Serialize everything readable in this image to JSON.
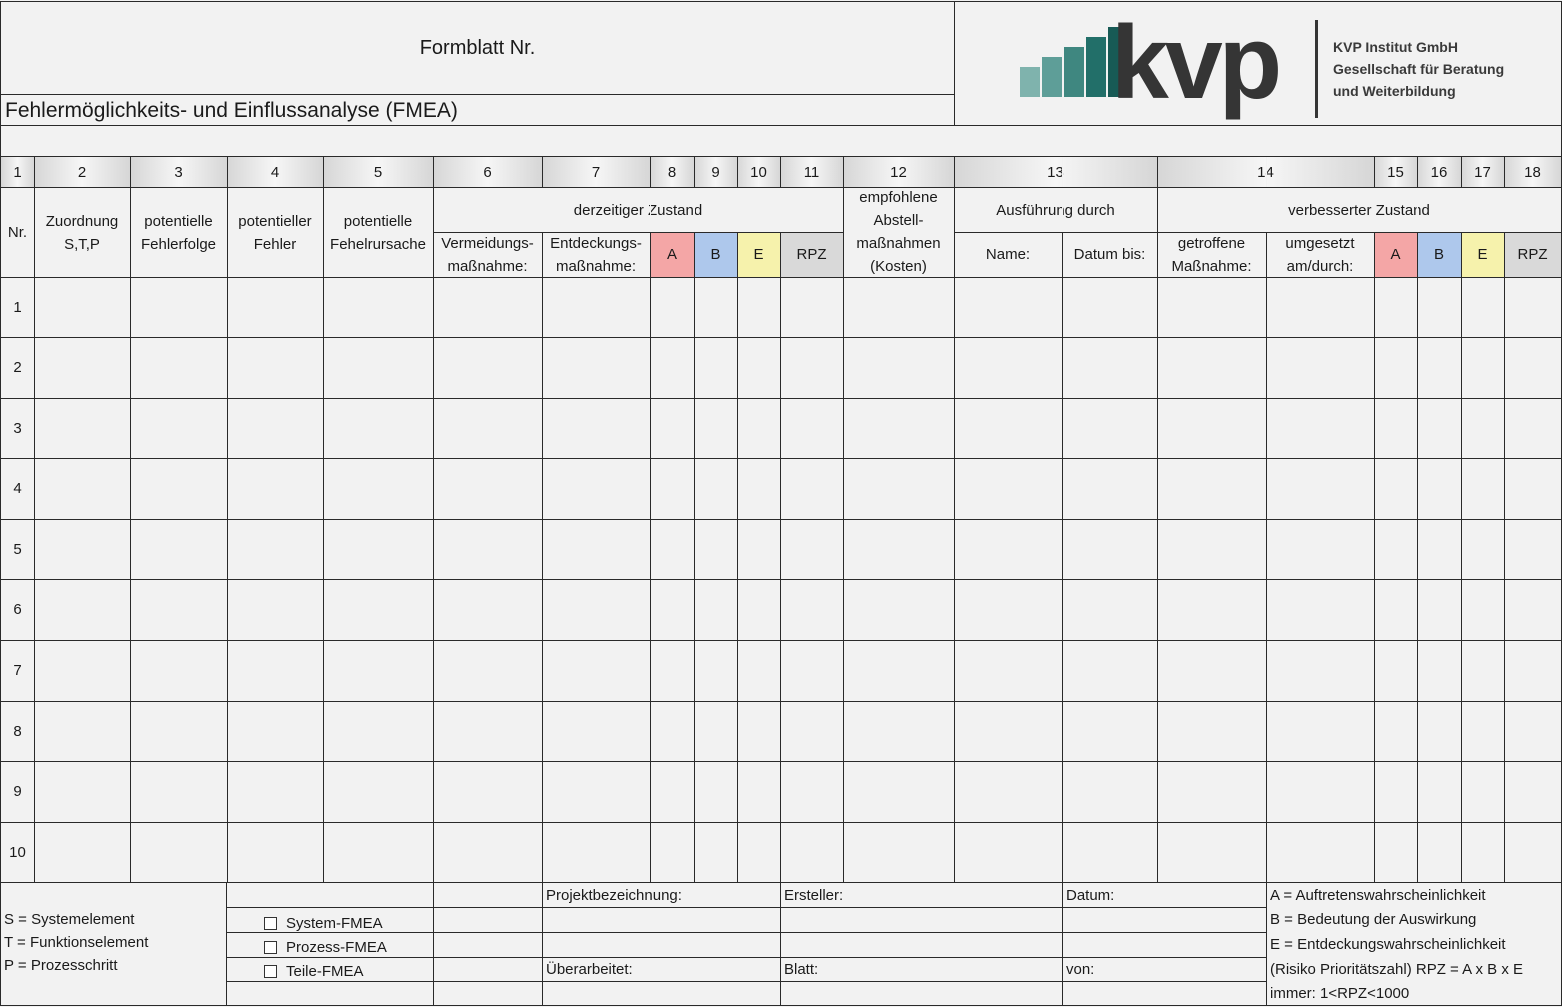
{
  "form": {
    "formblatt_label": "Formblatt Nr.",
    "title": "Fehlermöglichkeits- und Einflussanalyse (FMEA)"
  },
  "logo": {
    "wordmark": "kvp",
    "company_line1": "KVP Institut GmbH",
    "company_line2": "Gesellschaft für Beratung",
    "company_line3": "und Weiterbildung",
    "bar_colors": [
      "#7fb3ad",
      "#5e9e98",
      "#3f8780",
      "#226f69",
      "#175a55"
    ],
    "wordmark_color": "#353535"
  },
  "column_numbers": [
    "1",
    "2",
    "3",
    "4",
    "5",
    "6",
    "7",
    "8",
    "9",
    "10",
    "11",
    "12",
    "13",
    "14",
    "15",
    "16",
    "17",
    "18"
  ],
  "headers": {
    "nr": "Nr.",
    "zuordnung": "Zuordnung S,T,P",
    "fehlerfolge": "potentielle Fehlerfolge",
    "fehler": "potentieller Fehler",
    "fehlerursache": "potentielle Fehelrursache",
    "derzeitiger_zustand": "derzeitiger Zustand",
    "vermeidung": "Vermeidungs-maßnahme:",
    "entdeckung": "Entdeckungs-maßnahme:",
    "a": "A",
    "b": "B",
    "e": "E",
    "rpz": "RPZ",
    "empfohlene": "empfohlene Abstell-maßnahmen (Kosten)",
    "ausfuehrung": "Ausführung durch",
    "name": "Name:",
    "datum_bis": "Datum bis:",
    "verbesserter_zustand": "verbesserter Zustand",
    "getroffene": "getroffene Maßnahme:",
    "umgesetzt": "umgesetzt am/durch:",
    "a2": "A",
    "b2": "B",
    "e2": "E",
    "rpz2": "RPZ"
  },
  "rating_colors": {
    "a": "#f4a6a6",
    "b": "#aec8ec",
    "e": "#f6f2ac",
    "rpz": "#d9d9d9"
  },
  "row_numbers": [
    "1",
    "2",
    "3",
    "4",
    "5",
    "6",
    "7",
    "8",
    "9",
    "10"
  ],
  "legend": {
    "s": "S = Systemelement",
    "t": "T = Funktionselement",
    "p": "P = Prozesschritt"
  },
  "fmea_types": [
    "System-FMEA",
    "Prozess-FMEA",
    "Teile-FMEA"
  ],
  "footer": {
    "projektbezeichnung": "Projektbezeichnung:",
    "ersteller": "Ersteller:",
    "datum": "Datum:",
    "ueberarbeitet": "Überarbeitet:",
    "blatt": "Blatt:",
    "von": "von:",
    "notes": [
      "A = Auftretenswahrscheinlichkeit",
      "B = Bedeutung der Auswirkung",
      "E = Entdeckungswahrscheinlichkeit",
      "(Risiko Prioritätszahl) RPZ = A x B x E",
      "immer: 1<RPZ<1000"
    ]
  }
}
